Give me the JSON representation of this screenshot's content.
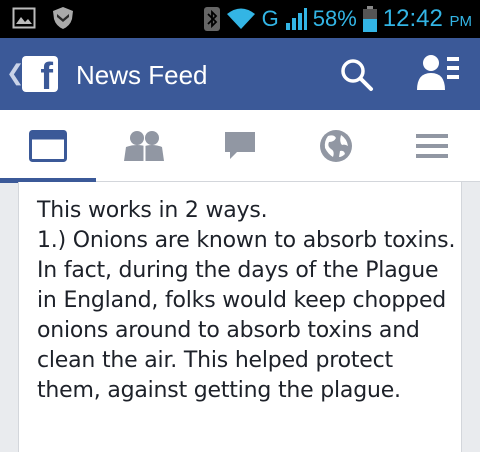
{
  "status_bar": {
    "battery": "58%",
    "network": "G",
    "time": "12:42",
    "ampm": "PM",
    "icons": [
      "image-icon",
      "shield-icon",
      "bluetooth-icon",
      "wifi-icon",
      "signal-icon",
      "battery-icon"
    ]
  },
  "app_bar": {
    "title": "News Feed",
    "color": "#3b5998",
    "icons": [
      "back-chevron-icon",
      "facebook-logo",
      "search-icon",
      "friend-requests-icon"
    ]
  },
  "tabs": [
    {
      "name": "news-feed",
      "icon": "news-feed-icon",
      "active": true
    },
    {
      "name": "friends",
      "icon": "friends-icon",
      "active": false
    },
    {
      "name": "messages",
      "icon": "chat-icon",
      "active": false
    },
    {
      "name": "notifications",
      "icon": "globe-icon",
      "active": false
    },
    {
      "name": "more",
      "icon": "menu-icon",
      "active": false
    }
  ],
  "post": {
    "text": "This works in 2 ways.\n1.) Onions are known to absorb toxins. In fact, during the days of the Plague in England, folks would keep chopped onions around to absorb toxins and clean the air. This helped protect them, against getting the plague."
  }
}
